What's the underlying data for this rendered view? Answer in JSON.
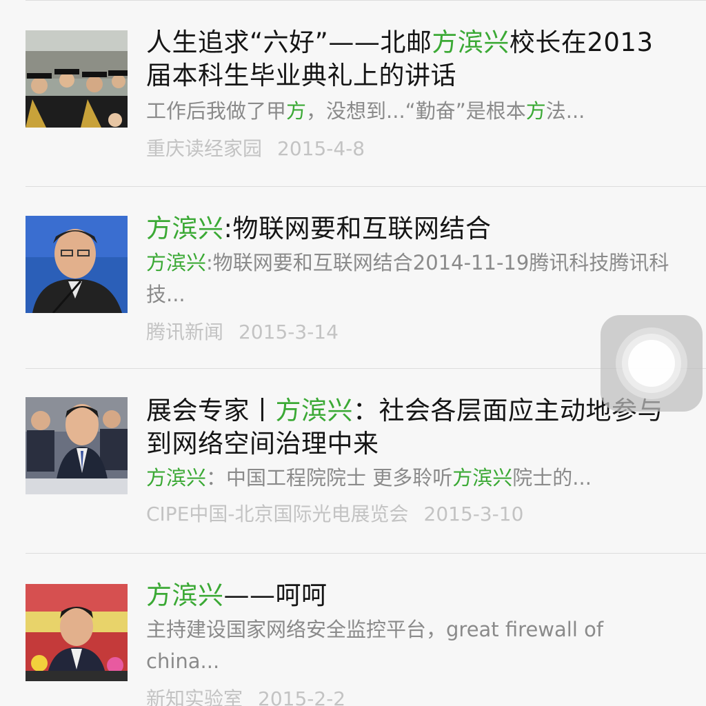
{
  "results": [
    {
      "title_parts": [
        "人生追求“六好”——北邮",
        "方滨兴",
        "校长在2013届本科生毕业典礼上的讲话"
      ],
      "snippet_parts": [
        "工作后我做了甲",
        "方",
        "，没想到...“勤奋”是根本",
        "方",
        "法..."
      ],
      "source": "重庆读经家园",
      "date": "2015-4-8",
      "thumbnail": "graduation-crowd-photo"
    },
    {
      "title_parts": [
        "方滨兴",
        ":物联网要和互联网结合"
      ],
      "snippet_parts": [
        "方滨兴",
        ":物联网要和互联网结合2014-11-19腾讯科技腾讯科技..."
      ],
      "source": "腾讯新闻",
      "date": "2015-3-14",
      "thumbnail": "speaker-microphone-photo"
    },
    {
      "title_parts": [
        "展会专家丨",
        "方滨兴",
        "：社会各层面应主动地参与到网络空间治理中来"
      ],
      "snippet_parts": [
        "方滨兴",
        "：中国工程院院士 更多聆听",
        "方滨兴",
        "院士的..."
      ],
      "source": "CIPE中国-北京国际光电展览会",
      "date": "2015-3-10",
      "thumbnail": "conference-speaker-photo"
    },
    {
      "title_parts": [
        "方滨兴",
        "——呵呵"
      ],
      "snippet_parts": [
        "主持建设国家网络安全监控平台，great firewall of china..."
      ],
      "source": "新知实验室",
      "date": "2015-2-2",
      "thumbnail": "event-speaker-photo"
    }
  ],
  "assistive_touch": "assistive-touch-button",
  "colors": {
    "highlight": "#3ba935",
    "title": "#151515",
    "snippet": "#8a8a8a",
    "meta": "#c3c3c3",
    "background": "#f7f7f7"
  }
}
